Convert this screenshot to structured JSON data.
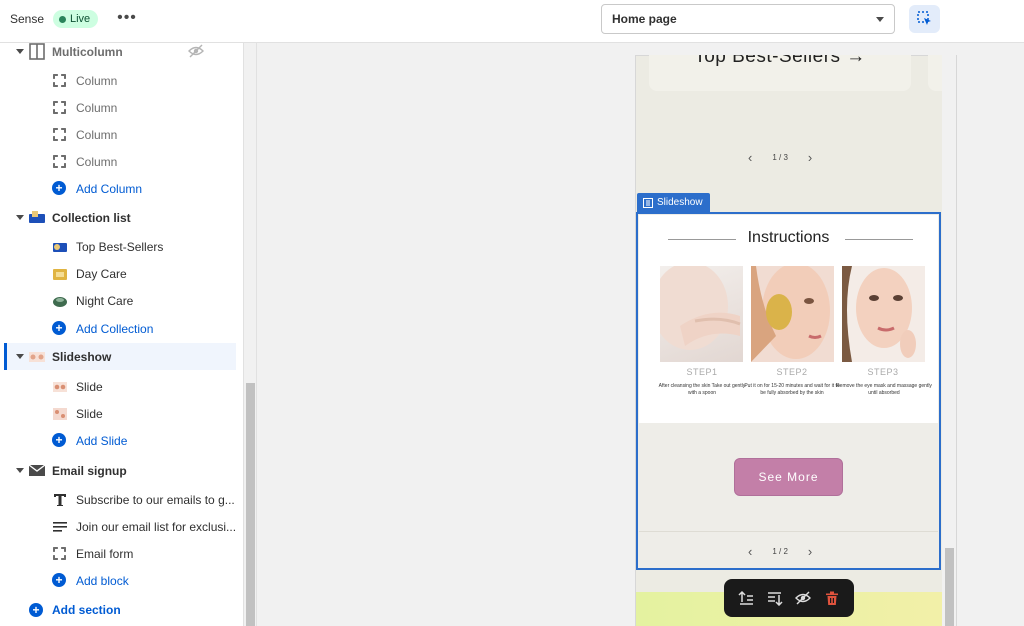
{
  "topbar": {
    "theme_name": "Sense",
    "status_badge": "Live",
    "more_label": "•••",
    "page_select_value": "Home page"
  },
  "sidebar": {
    "multicolumn": {
      "label": "Multicolumn",
      "blocks": [
        "Column",
        "Column",
        "Column",
        "Column"
      ],
      "add_label": "Add Column"
    },
    "collection_list": {
      "label": "Collection list",
      "blocks": [
        "Top Best-Sellers",
        "Day Care",
        "Night Care"
      ],
      "add_label": "Add Collection"
    },
    "slideshow": {
      "label": "Slideshow",
      "blocks": [
        "Slide",
        "Slide"
      ],
      "add_label": "Add Slide"
    },
    "email_signup": {
      "label": "Email signup",
      "blocks": [
        "Subscribe to our emails to g...",
        "Join our email list for exclusi...",
        "Email form"
      ],
      "add_label": "Add block"
    },
    "add_section_label": "Add section"
  },
  "preview": {
    "bestsellers_heading": "Top Best-Sellers →",
    "collection_pager": "1 / 3",
    "slideshow_tag": "Slideshow",
    "instructions_title": "Instructions",
    "steps": [
      {
        "label": "STEP1",
        "desc": "After cleansing the skin Take out gently with a spoon"
      },
      {
        "label": "STEP2",
        "desc": "Put it on for 15-20 minutes and wait for it to be fully absorbed by the skin"
      },
      {
        "label": "STEP3",
        "desc": "Remove the eye mask and massage gently until absorbed"
      }
    ],
    "see_more_label": "See More",
    "slideshow_pager": "1 / 2"
  },
  "colors": {
    "accent": "#005bd3",
    "selection_blue": "#2c6ecb",
    "button_pink": "#c37fa8",
    "live_bg": "#cdfee1",
    "delete_red": "#e0533d"
  }
}
